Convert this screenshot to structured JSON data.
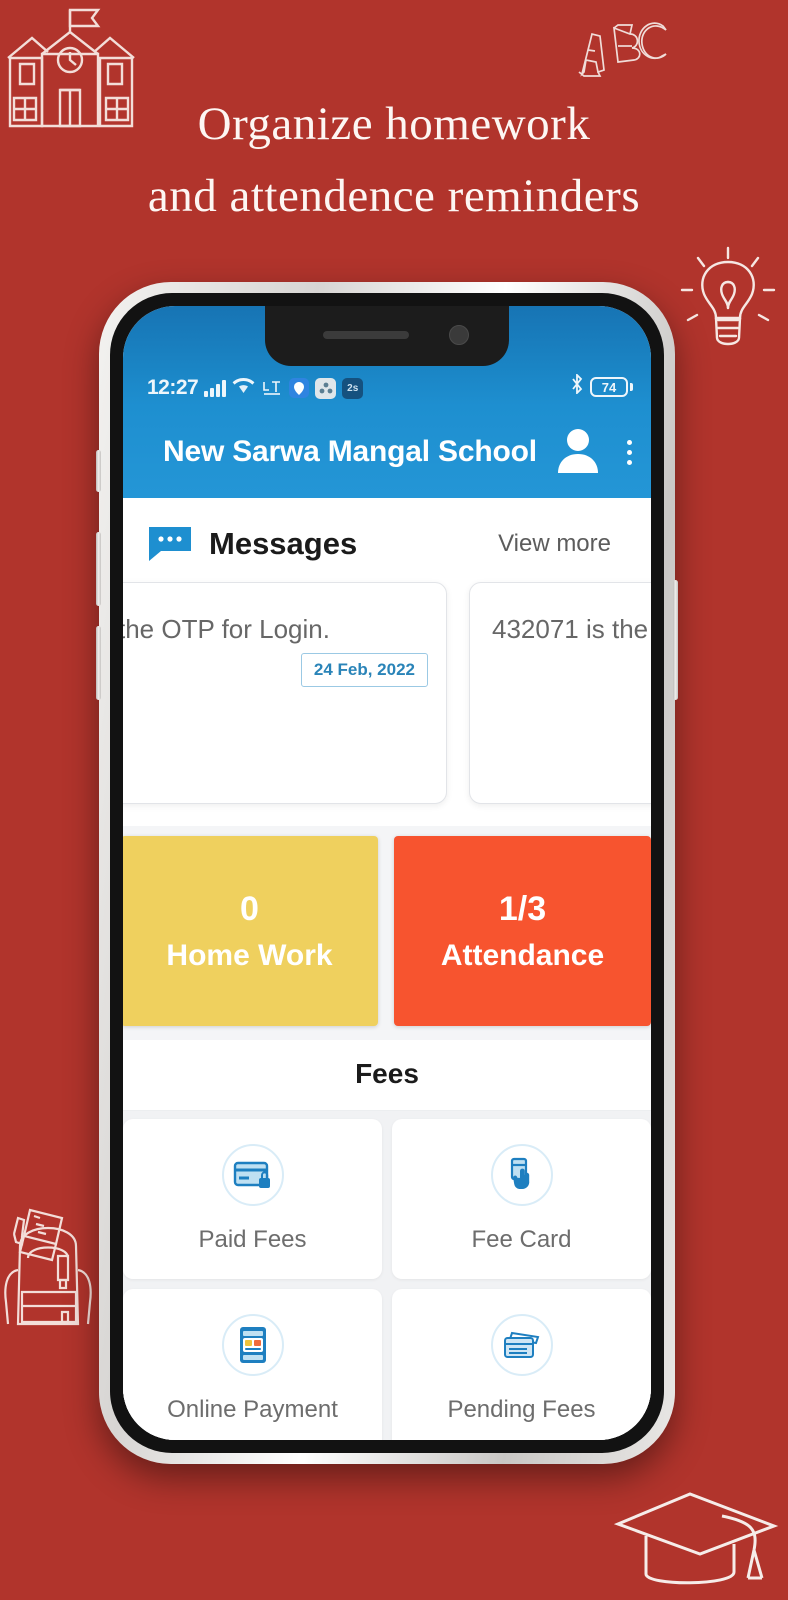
{
  "page": {
    "background_color": "#b1342c",
    "headline_line1": "Organize homework",
    "headline_line2": "and  attendence reminders"
  },
  "decorations": [
    {
      "name": "school-building",
      "label": "school building outline"
    },
    {
      "name": "abc-letters",
      "label": "ABC"
    },
    {
      "name": "lightbulb",
      "label": "idea lightbulb"
    },
    {
      "name": "backpack",
      "label": "school backpack"
    },
    {
      "name": "graduation-cap",
      "label": "graduation cap"
    }
  ],
  "phone": {
    "status_bar": {
      "time": "12:27",
      "battery_level": "74",
      "lte_label": "LTE",
      "icons": [
        "signal-bars",
        "wifi",
        "lte",
        "location-pin",
        "app-badge-1",
        "app-badge-2",
        "bluetooth",
        "battery"
      ]
    },
    "app_bar": {
      "title": "New Sarwa Mangal School",
      "menu_icon": "hamburger-menu-icon",
      "profile_icon": "person-icon",
      "overflow_icon": "kebab-menu-icon"
    },
    "messages": {
      "title": "Messages",
      "view_more": "View more",
      "icon": "chat-bubble-icon",
      "cards": [
        {
          "text": "the OTP for Login.",
          "date": "24 Feb, 2022"
        },
        {
          "text": "432071 is the",
          "date": ""
        }
      ]
    },
    "tiles": [
      {
        "value": "0",
        "label": "Home Work",
        "color": "#efd05e"
      },
      {
        "value": "1/3",
        "label": "Attendance",
        "color": "#f7542f"
      }
    ],
    "fees": {
      "section_title": "Fees",
      "items": [
        {
          "label": "Paid Fees",
          "icon": "locked-card-icon"
        },
        {
          "label": "Fee Card",
          "icon": "hand-card-icon"
        },
        {
          "label": "Online Payment",
          "icon": "mobile-payment-icon"
        },
        {
          "label": "Pending Fees",
          "icon": "stacked-cards-icon"
        }
      ]
    }
  }
}
